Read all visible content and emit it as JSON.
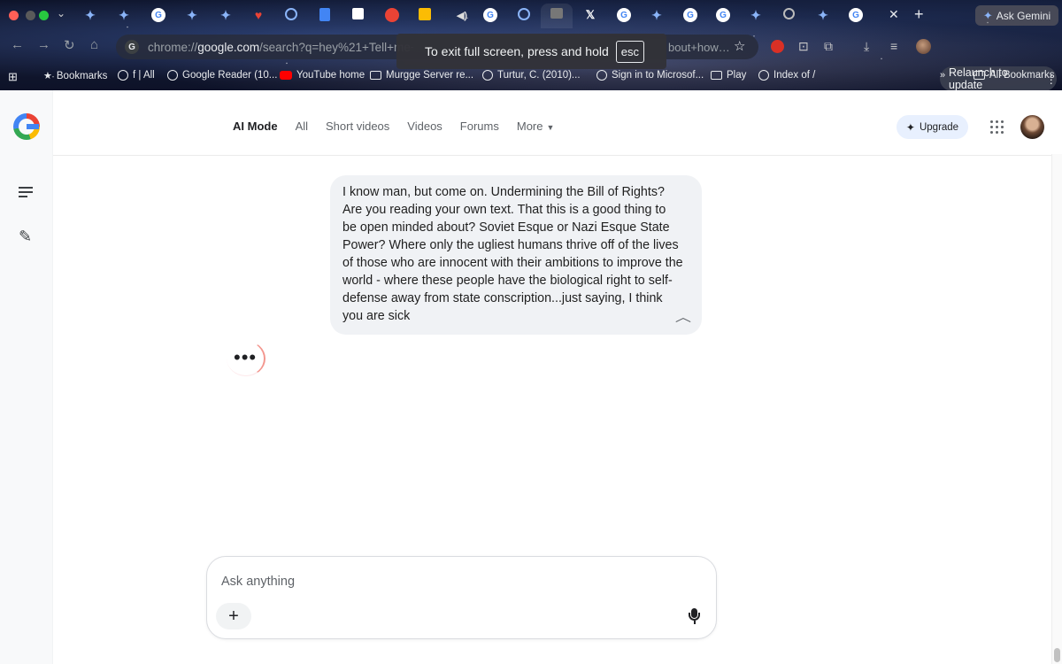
{
  "browser": {
    "tab_strip": {
      "close_glyph": "✕",
      "new_tab_glyph": "+",
      "ask_gemini_label": "Ask Gemini"
    },
    "omnibox": {
      "url_scheme": "chrome://",
      "url_host": "google.com",
      "url_path": "/search?q=hey%21+Tell+me+th",
      "url_tail": "bout+how…"
    },
    "fullscreen_toast": {
      "message": "To exit full screen, press and hold",
      "key": "esc"
    },
    "relaunch_label": "Relaunch to update",
    "bookmarks": [
      {
        "label": "Bookmarks",
        "icon": "star-icon"
      },
      {
        "label": "f | All",
        "icon": "globe-icon"
      },
      {
        "label": "Google Reader (10...",
        "icon": "globe-icon"
      },
      {
        "label": "YouTube home",
        "icon": "youtube-icon"
      },
      {
        "label": "Murgge Server re...",
        "icon": "folder-icon"
      },
      {
        "label": "Turtur, C. (2010)...",
        "icon": "globe-icon"
      },
      {
        "label": "Sign in to Microsof...",
        "icon": "globe-icon"
      },
      {
        "label": "Play",
        "icon": "folder-icon"
      },
      {
        "label": "Index of /",
        "icon": "globe-icon"
      },
      {
        "label": "All Bookmarks",
        "icon": "folder-icon"
      }
    ]
  },
  "search": {
    "tabs": [
      {
        "label": "AI Mode",
        "active": true
      },
      {
        "label": "All",
        "active": false
      },
      {
        "label": "Short videos",
        "active": false
      },
      {
        "label": "Videos",
        "active": false
      },
      {
        "label": "Forums",
        "active": false
      },
      {
        "label": "More",
        "active": false
      }
    ],
    "upgrade_label": "Upgrade"
  },
  "conversation": {
    "user_message": "I know man, but come on. Undermining the Bill of Rights? Are you reading your own text. That this is a good thing to be open minded about? Soviet Esque or Nazi Esque State Power? Where only the ugliest humans thrive off of the lives of those who are innocent with their ambitions to improve the world - where these people have the biological right to self-defense away from state conscription...just saying, I think you are sick"
  },
  "composer": {
    "placeholder": "Ask anything"
  },
  "colors": {
    "accent_blue": "#4285f4",
    "upgrade_bg": "#e8f0fe",
    "bubble_bg": "#f0f2f5",
    "loader_arc": "#f28b82"
  }
}
